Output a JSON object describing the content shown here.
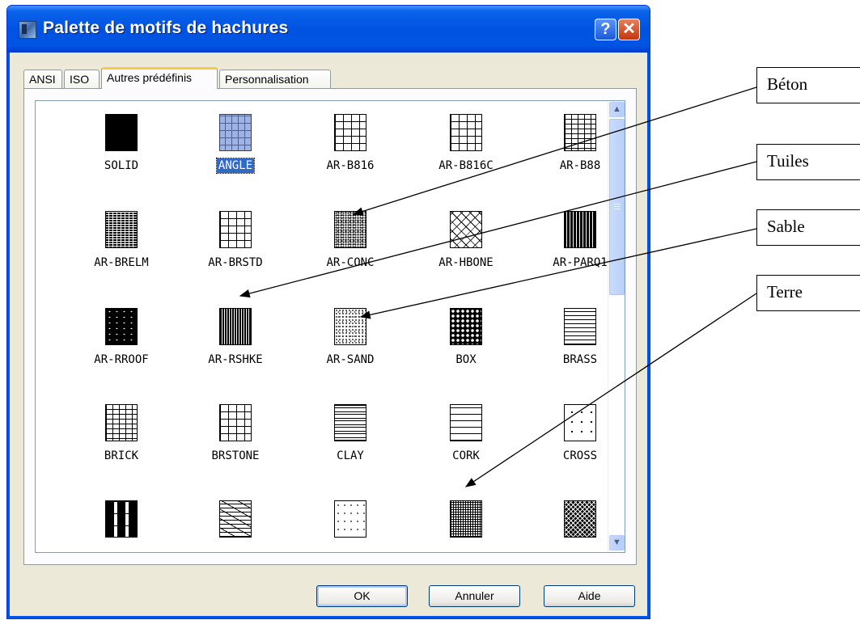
{
  "window": {
    "title": "Palette de motifs de hachures",
    "help_glyph": "?",
    "close_glyph": "✕"
  },
  "tabs": [
    {
      "label": "ANSI"
    },
    {
      "label": "ISO"
    },
    {
      "label": "Autres prédéfinis",
      "active": true
    },
    {
      "label": "Personnalisation"
    }
  ],
  "patterns": [
    {
      "name": "SOLID",
      "pattern": "solid"
    },
    {
      "name": "ANGLE",
      "pattern": "angle",
      "selected": true
    },
    {
      "name": "AR-B816",
      "pattern": "brick"
    },
    {
      "name": "AR-B816C",
      "pattern": "brick"
    },
    {
      "name": "AR-B88",
      "pattern": "brick-s"
    },
    {
      "name": "AR-BRELM",
      "pattern": "dense"
    },
    {
      "name": "AR-BRSTD",
      "pattern": "brick"
    },
    {
      "name": "AR-CONC",
      "pattern": "conc"
    },
    {
      "name": "AR-HBONE",
      "pattern": "hbone"
    },
    {
      "name": "AR-PARQ1",
      "pattern": "parq"
    },
    {
      "name": "AR-RROOF",
      "pattern": "roof"
    },
    {
      "name": "AR-RSHKE",
      "pattern": "shke"
    },
    {
      "name": "AR-SAND",
      "pattern": "sand"
    },
    {
      "name": "BOX",
      "pattern": "box"
    },
    {
      "name": "BRASS",
      "pattern": "brass"
    },
    {
      "name": "BRICK",
      "pattern": "brick-s"
    },
    {
      "name": "BRSTONE",
      "pattern": "brick"
    },
    {
      "name": "CLAY",
      "pattern": "clay"
    },
    {
      "name": "CORK",
      "pattern": "cork"
    },
    {
      "name": "CROSS",
      "pattern": "cross"
    },
    {
      "name": "",
      "pattern": "dash"
    },
    {
      "name": "",
      "pattern": "line"
    },
    {
      "name": "",
      "pattern": "dots"
    },
    {
      "name": "",
      "pattern": "basket"
    },
    {
      "name": "",
      "pattern": "earth"
    }
  ],
  "scrollbar": {
    "up_glyph": "▲",
    "down_glyph": "▼"
  },
  "buttons": {
    "ok": "OK",
    "cancel": "Annuler",
    "help": "Aide"
  },
  "annotations": [
    {
      "label": "Béton",
      "target": "AR-CONC"
    },
    {
      "label": "Tuiles",
      "target": "AR-RSHKE"
    },
    {
      "label": "Sable",
      "target": "AR-SAND"
    },
    {
      "label": "Terre",
      "target": "pattern row 5 column 4"
    }
  ],
  "colors": {
    "titlebar": "#0054e3",
    "dialog_bg": "#ece9d8",
    "selection": "#316ac5",
    "active_tab_accent": "#ffc83c"
  }
}
